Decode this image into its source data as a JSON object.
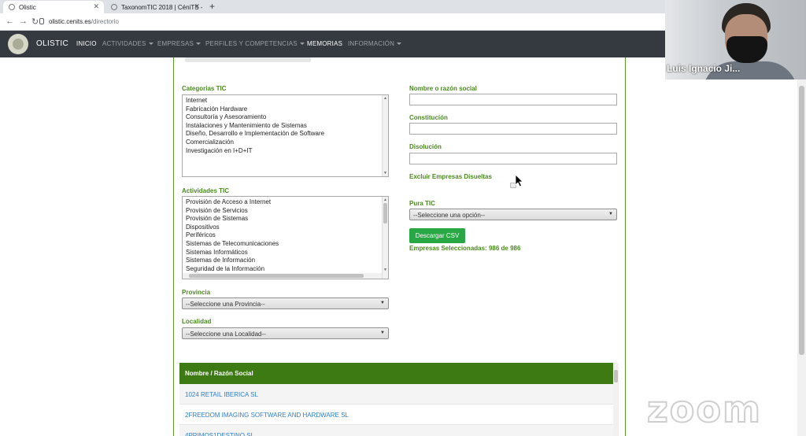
{
  "browser": {
    "tabs": [
      {
        "title": "Olistic"
      },
      {
        "title": "TaxonomTIC 2018 | CéniTS -"
      }
    ],
    "url_host": "olistic.cenits.es",
    "url_path": "/directorio"
  },
  "site": {
    "brand": "OLISTIC",
    "nav": [
      "INICIO",
      "ACTIVIDADES",
      "EMPRESAS",
      "PERFILES Y COMPETENCIAS",
      "MEMORIAS",
      "INFORMACIÓN"
    ]
  },
  "filters": {
    "categorias_label": "Categorias TIC",
    "categorias": [
      "Internet",
      "Fabricación Hardware",
      "Consultoría y Asesoramiento",
      "Instalaciones y Mantenimiento de Sistemas",
      "Diseño, Desarrollo e Implementación de Software",
      "Comercialización",
      "Investigación en I+D+IT"
    ],
    "actividades_label": "Actividades TIC",
    "actividades": [
      "Provisión de Acceso a Internet",
      "Provisión de Servicios",
      "Provisión de Sistemas",
      "Dispositivos",
      "Periféricos",
      "Sistemas de Telecomunicaciones",
      "Sistemas Informáticos",
      "Sistemas de Información",
      "Seguridad de la Información"
    ],
    "provincia_label": "Provincia",
    "provincia_value": "--Seleccione una Provincia--",
    "localidad_label": "Localidad",
    "localidad_value": "--Seleccione una Localidad--",
    "nombre_label": "Nombre o razón social",
    "constitucion_label": "Constitución",
    "disolucion_label": "Disolución",
    "excluir_label": "Excluir Empresas Disueltas",
    "pura_label": "Pura TIC",
    "pura_value": "--Seleccione una opción--",
    "csv_button": "Descargar CSV",
    "seleccionadas": "Empresas Seleccionadas: 986 de 986"
  },
  "table": {
    "header": "Nombre / Razón Social",
    "rows": [
      "1024 RETAIL IBERICA SL",
      "2FREEDOM IMAGING SOFTWARE AND HARDWARE SL",
      "4PRIMOS1DESTINO SL"
    ]
  },
  "video": {
    "participant": "Luis Ignacio Ji..."
  },
  "watermark": "zoom",
  "colors": {
    "accent_green": "#4a8a1f",
    "table_header": "#3d7a13",
    "button_green": "#28a745",
    "nav_bg": "#343a40",
    "link_blue": "#2c7fcf"
  }
}
